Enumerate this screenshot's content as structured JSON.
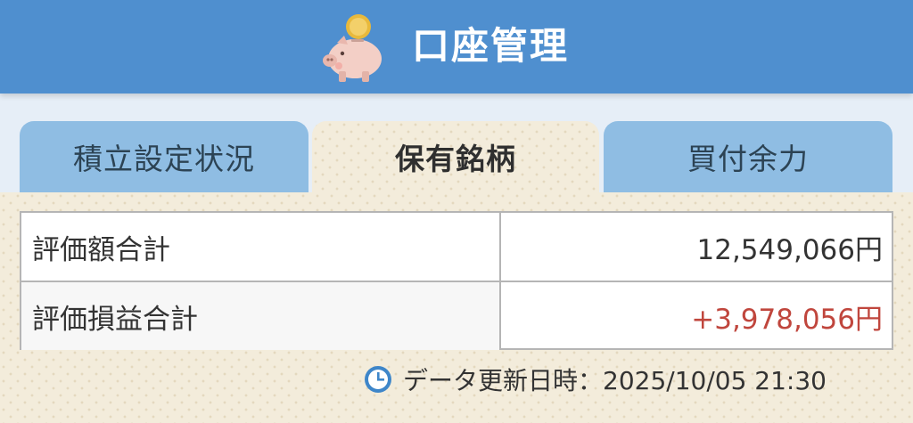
{
  "header": {
    "title": "口座管理",
    "icon": "piggy-bank-coin-icon",
    "bg_color": "#4f8fcf"
  },
  "tabs": [
    {
      "label": "積立設定状況",
      "active": false
    },
    {
      "label": "保有銘柄",
      "active": true
    },
    {
      "label": "買付余力",
      "active": false
    }
  ],
  "summary": {
    "rows": [
      {
        "label": "評価額合計",
        "value": "12,549,066円"
      },
      {
        "label": "評価損益合計",
        "value": "+3,978,056円",
        "color": "#c0463d"
      }
    ]
  },
  "updated": {
    "icon": "clock-icon",
    "text": "データ更新日時：2025/10/05 21:30"
  }
}
